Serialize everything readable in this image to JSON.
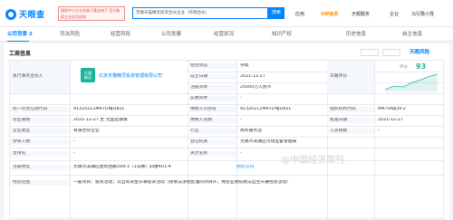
{
  "header": {
    "logo_text": "天眼查",
    "gov_badge_text": "国家中小企业发展子基金旗下 官方备案企业征信机构",
    "search_value": "无锡天猫精灵投资合伙企业（有限合伙）",
    "search_button": "搜索",
    "nav": {
      "app": "应用",
      "vip": "VIP会员",
      "product": "天眼服务",
      "company_news": "企业",
      "user": "马引豫小怪"
    }
  },
  "tabs": [
    {
      "label": "公司背景",
      "count": "2",
      "active": true
    },
    {
      "label": "司法风险",
      "active": false
    },
    {
      "label": "经营风险",
      "active": false
    },
    {
      "label": "公司发展",
      "active": false
    },
    {
      "label": "经营状况",
      "active": false
    },
    {
      "label": "知识产权",
      "active": false
    },
    {
      "label": "历史信息",
      "active": false
    },
    {
      "label": "自主信息",
      "active": false
    }
  ],
  "card": {
    "title": "工商信息",
    "brand": "天眼风险",
    "partner_label": "执行事务合伙人",
    "stamp_line1": "天猫",
    "stamp_line2": "精灵",
    "partner_name": "北京天猫精灵投资管理有限公司"
  },
  "fields": {
    "status_label": "经营状态",
    "status_value": "存续",
    "founded_label": "成立日期",
    "founded_value": "2021-12-27",
    "capital_label": "注册资本",
    "capital_value": "25000万人民币",
    "paid_capital_label": "实缴资本",
    "paid_capital_value": "-",
    "credit_code_label": "统一社会信用代码",
    "credit_code_value": "91320211MA7DNJQ92L",
    "tax_id_label": "纳税人识别号",
    "tax_id_value": "91320211MA7DNJQ92L",
    "org_code_label": "组织机构代码",
    "org_code_value": "MA7DNJQ9-2",
    "biz_term_label": "营业期限",
    "biz_term_value": "2021-12-27 至 无固定期限",
    "taxpayer_label": "纳税人资质",
    "taxpayer_value": "-",
    "approve_date_label": "核准日期",
    "approve_date_value": "2021-12-27",
    "company_type_label": "企业类型",
    "company_type_value": "有限合伙企业",
    "industry_label": "行业",
    "industry_value": "商务服务业",
    "staff_size_label": "人员规模",
    "staff_size_value": "-",
    "insured_label": "参保人数",
    "insured_value": "-",
    "registry_label": "登记机关",
    "registry_value": "无锡市滨湖区市场监督管理局",
    "former_name_label": "曾用名",
    "former_name_value": "-",
    "english_name_label": "英文名称",
    "english_name_value": "-",
    "address_label": "注册地址",
    "address_value": "无锡市滨湖区建筑西路599-3（1号楼）四楼401-4",
    "address_link": "附近公司",
    "scope_label": "经营范围",
    "scope_value": "一般项目：投资活动；以自有资金从事投资活动（除依法须经批准的项目外，凭营业执照依法自主开展经营活动）"
  },
  "score": {
    "label": "天眼评分",
    "value": "93",
    "sub": "评分"
  },
  "watermark": "@中国经济周刊"
}
